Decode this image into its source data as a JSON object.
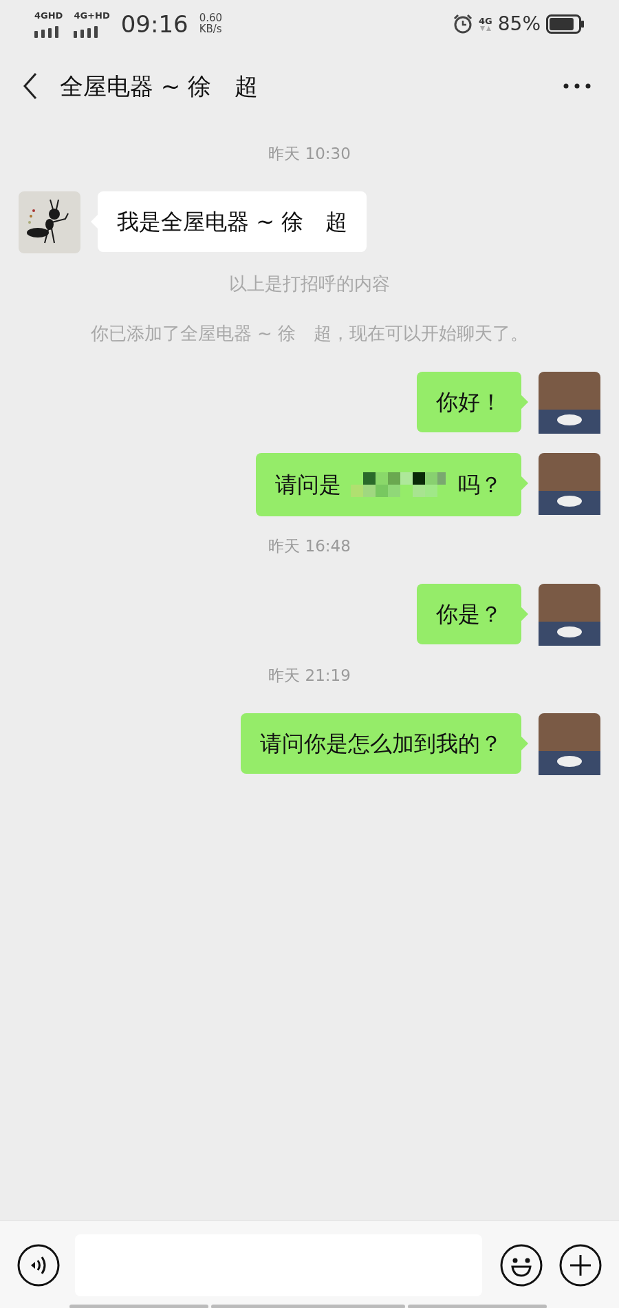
{
  "status_bar": {
    "sim_1": "4GHD",
    "sim_2": "4G+HD",
    "time": "09:16",
    "speed_value": "0.60",
    "speed_unit": "KB/s",
    "network": "4G",
    "battery_text": "85%",
    "battery": {
      "level": 0.85
    }
  },
  "header": {
    "title": "全屋电器 ~ 徐　超"
  },
  "chat": [
    {
      "kind": "timestamp",
      "text": "昨天 10:30"
    },
    {
      "kind": "incoming_message",
      "text": "我是全屋电器 ~ 徐　超"
    },
    {
      "kind": "system",
      "text": "以上是打招呼的内容"
    },
    {
      "kind": "system",
      "text": "你已添加了全屋电器 ~ 徐　超，现在可以开始聊天了。"
    },
    {
      "kind": "outgoing_message",
      "text": "你好！"
    },
    {
      "kind": "outgoing_redacted_message",
      "text_before": "请问是",
      "text_after": "吗？"
    },
    {
      "kind": "timestamp",
      "text": "昨天 16:48"
    },
    {
      "kind": "outgoing_message",
      "text": "你是？"
    },
    {
      "kind": "timestamp",
      "text": "昨天 21:19"
    },
    {
      "kind": "outgoing_message",
      "text": "请问你是怎么加到我的？"
    }
  ]
}
